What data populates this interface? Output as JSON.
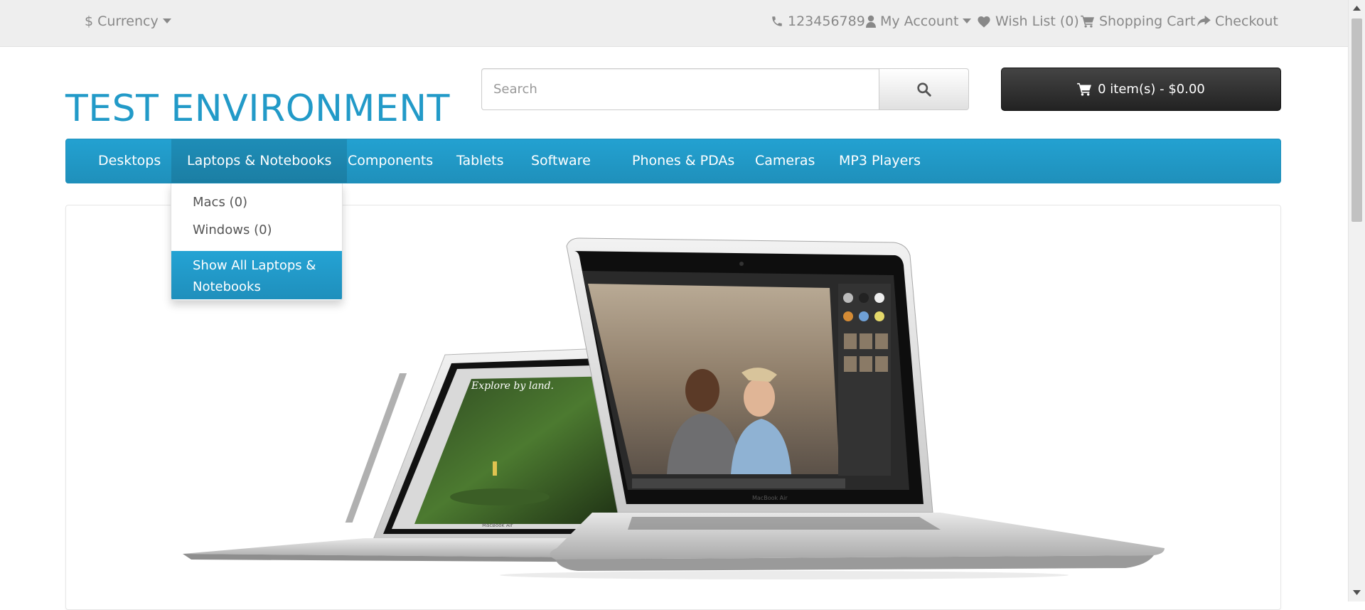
{
  "top_bar": {
    "currency": "Currency",
    "phone": "123456789",
    "my_account": "My Account",
    "wish_list": "Wish List (0)",
    "shopping_cart": "Shopping Cart",
    "checkout": "Checkout"
  },
  "header": {
    "logo_text": "TEST ENVIRONMENT",
    "search_placeholder": "Search",
    "cart_total": "0 item(s) - $0.00"
  },
  "menu": {
    "items": [
      "Desktops",
      "Laptops & Notebooks",
      "Components",
      "Tablets",
      "Software",
      "Phones & PDAs",
      "Cameras",
      "MP3 Players"
    ],
    "active_item": "Laptops & Notebooks"
  },
  "dropdown": {
    "links": [
      "Macs (0)",
      "Windows (0)"
    ],
    "show_all": "Show All Laptops & Notebooks"
  },
  "banner": {
    "screen_text": "Explore by land.",
    "laptop_brand": "MacBook Air"
  },
  "colors": {
    "accent": "#229ac8",
    "menu_bg": "#1f90bb",
    "cart_bg": "#333333",
    "top_bar_bg": "#eeeeee"
  },
  "icons": {
    "currency": "dollar-icon",
    "phone": "phone-icon",
    "account": "user-icon",
    "wish_list": "heart-icon",
    "cart": "shopping-cart-icon",
    "checkout": "share-icon",
    "search": "search-icon"
  }
}
